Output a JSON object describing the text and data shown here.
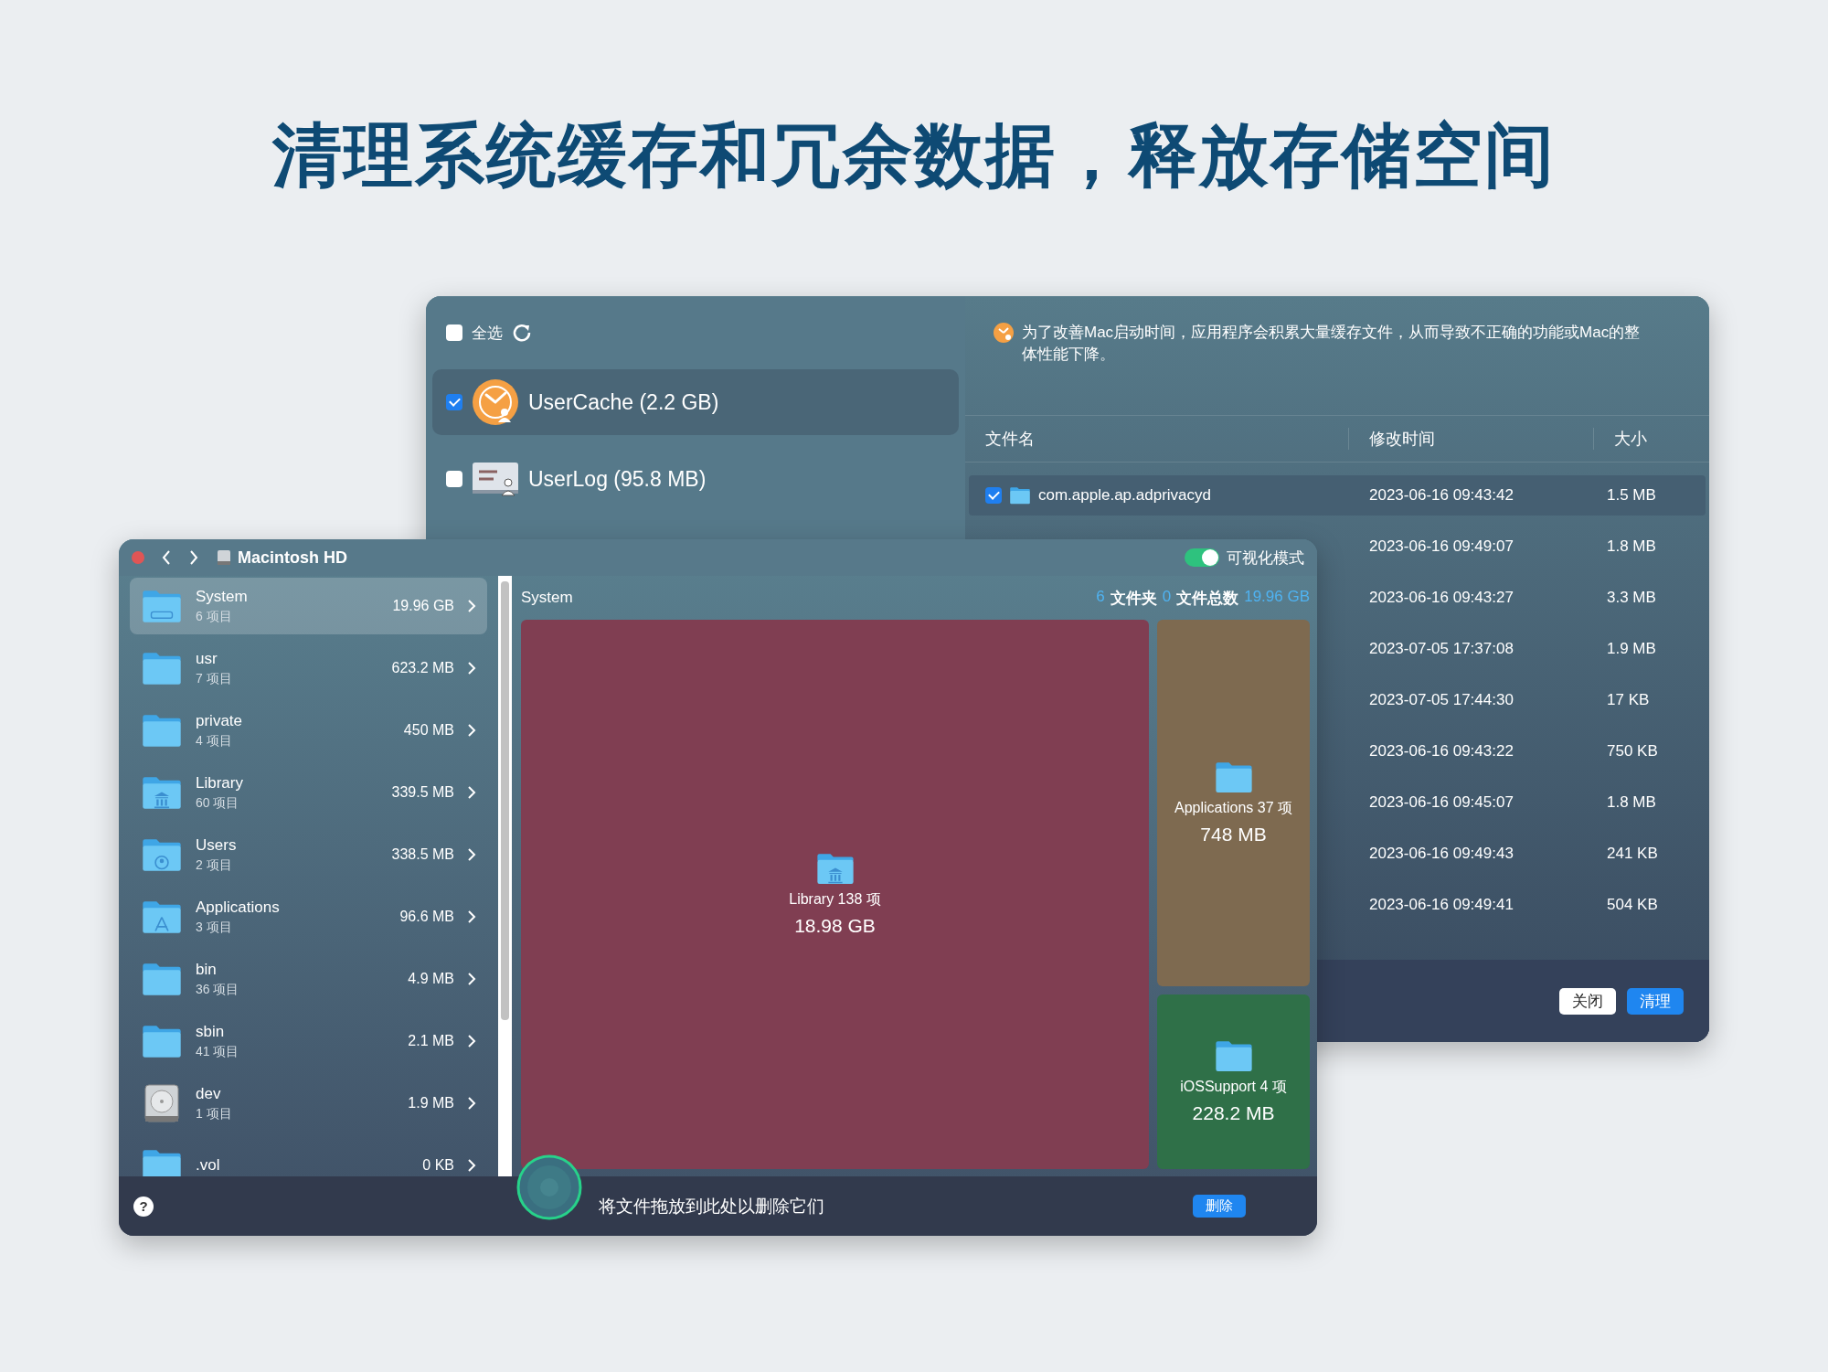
{
  "headline": "清理系统缓存和冗余数据，释放存储空间",
  "cleaner_window": {
    "select_all": {
      "label": "全选",
      "checked": false
    },
    "categories": [
      {
        "name": "UserCache (2.2 GB)",
        "kind": "cache",
        "checked": true,
        "selected": true
      },
      {
        "name": "UserLog (95.8 MB)",
        "kind": "log",
        "checked": false,
        "selected": false
      }
    ],
    "description": "为了改善Mac启动时间，应用程序会积累大量缓存文件，从而导致不正确的功能或Mac的整体性能下降。",
    "table": {
      "columns": [
        "文件名",
        "修改时间",
        "大小"
      ],
      "rows": [
        {
          "name": "com.apple.ap.adprivacyd",
          "modified": "2023-06-16 09:43:42",
          "size": "1.5 MB",
          "checked": true,
          "selected": true
        },
        {
          "modified": "2023-06-16 09:49:07",
          "size": "1.8 MB"
        },
        {
          "modified": "2023-06-16 09:43:27",
          "size": "3.3 MB"
        },
        {
          "modified": "2023-07-05 17:37:08",
          "size": "1.9 MB"
        },
        {
          "modified": "2023-07-05 17:44:30",
          "size": "17 KB"
        },
        {
          "modified": "2023-06-16 09:43:22",
          "size": "750 KB"
        },
        {
          "modified": "2023-06-16 09:45:07",
          "size": "1.8 MB"
        },
        {
          "modified": "2023-06-16 09:49:43",
          "size": "241 KB"
        },
        {
          "modified": "2023-06-16 09:49:41",
          "size": "504 KB"
        }
      ]
    },
    "buttons": [
      {
        "label": "关闭",
        "kind": "secondary"
      },
      {
        "label": "清理",
        "kind": "primary"
      }
    ]
  },
  "disk_browser": {
    "title": "Macintosh HD",
    "visual_mode": {
      "label": "可视化模式",
      "on": true
    },
    "items": [
      {
        "name": "System",
        "count": "6 项目",
        "size": "19.96 GB",
        "kind": "system",
        "selected": true
      },
      {
        "name": "usr",
        "count": "7 项目",
        "size": "623.2 MB",
        "kind": "folder",
        "selected": false
      },
      {
        "name": "private",
        "count": "4 项目",
        "size": "450 MB",
        "kind": "folder",
        "selected": false
      },
      {
        "name": "Library",
        "count": "60 项目",
        "size": "339.5 MB",
        "kind": "library",
        "selected": false
      },
      {
        "name": "Users",
        "count": "2 项目",
        "size": "338.5 MB",
        "kind": "users",
        "selected": false
      },
      {
        "name": "Applications",
        "count": "3 项目",
        "size": "96.6 MB",
        "kind": "applications",
        "selected": false
      },
      {
        "name": "bin",
        "count": "36 项目",
        "size": "4.9 MB",
        "kind": "folder",
        "selected": false
      },
      {
        "name": "sbin",
        "count": "41 项目",
        "size": "2.1 MB",
        "kind": "folder",
        "selected": false
      },
      {
        "name": "dev",
        "count": "1 项目",
        "size": "1.9 MB",
        "kind": "disk",
        "selected": false
      },
      {
        "name": ".vol",
        "size": "0 KB",
        "kind": "folder",
        "selected": false
      }
    ],
    "current": "System",
    "stats": [
      {
        "text": "6",
        "kind": "number"
      },
      {
        "text": "文件夹",
        "kind": "label"
      },
      {
        "text": "0",
        "kind": "number"
      },
      {
        "text": "文件总数",
        "kind": "label"
      },
      {
        "text": "19.96 GB",
        "kind": "number"
      }
    ],
    "tiles": [
      {
        "name": "Library 138 项",
        "size": "18.98 GB",
        "kind": "library",
        "color": "#803e52"
      },
      {
        "name": "Applications 37 项",
        "size": "748 MB",
        "kind": "folder",
        "color": "#7e6a50"
      },
      {
        "name": "iOSSupport 4 项",
        "size": "228.2 MB",
        "kind": "folder",
        "color": "#2f7048"
      }
    ],
    "help": "?",
    "drop_hint": "将文件拖放到此处以删除它们",
    "delete_button": "删除"
  }
}
